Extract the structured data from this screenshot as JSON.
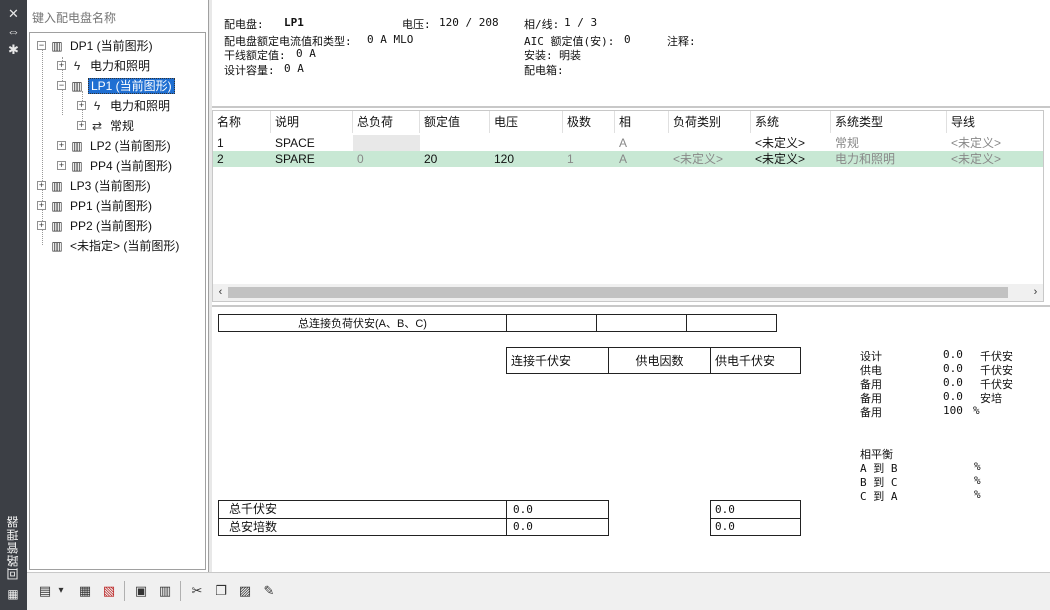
{
  "strip": {
    "title": "回路管理器",
    "close_glyph": "✕",
    "pin_glyph": "⇔",
    "settings_glyph": "✱",
    "bottom_glyph": "▦"
  },
  "tree": {
    "search_placeholder": "键入配电盘名称",
    "items": [
      {
        "label": "DP1 (当前图形)",
        "icon": "panel-icon",
        "expand": "−"
      },
      {
        "label": "电力和照明",
        "icon": "power-icon",
        "expand": "+"
      },
      {
        "label": "LP1 (当前图形)",
        "icon": "panel-icon",
        "expand": "−"
      },
      {
        "label": "电力和照明",
        "icon": "power-icon",
        "expand": "+"
      },
      {
        "label": "常规",
        "icon": "general-icon",
        "expand": "+"
      },
      {
        "label": "LP2 (当前图形)",
        "icon": "panel-icon",
        "expand": "+"
      },
      {
        "label": "PP4 (当前图形)",
        "icon": "panel-icon",
        "expand": "+"
      },
      {
        "label": "LP3 (当前图形)",
        "icon": "panel-icon",
        "expand": "+"
      },
      {
        "label": "PP1 (当前图形)",
        "icon": "panel-icon",
        "expand": "+"
      },
      {
        "label": "PP2 (当前图形)",
        "icon": "panel-icon",
        "expand": "+"
      },
      {
        "label": "<未指定> (当前图形)",
        "icon": "panel-icon",
        "expand": ""
      }
    ]
  },
  "header": {
    "panel_label": "配电盘:",
    "panel_value": "LP1",
    "voltage_label": "电压:",
    "voltage_value": "120 / 208",
    "phase_label": "相/线:",
    "phase_value": "1 / 3",
    "rating_label": "配电盘额定电流值和类型:",
    "rating_value": "0 A MLO",
    "aic_label": "AIC 额定值(安):",
    "aic_value": "0",
    "note_label": "注释:",
    "main_label": "干线额定值:",
    "main_value": "0 A",
    "mount_label": "安装:",
    "mount_value": "明装",
    "design_label": "设计容量:",
    "design_value": "0 A",
    "enclosure_label": "配电箱:"
  },
  "grid": {
    "columns": [
      "名称",
      "说明",
      "总负荷",
      "额定值",
      "电压",
      "极数",
      "相",
      "负荷类别",
      "系统",
      "系统类型",
      "导线"
    ],
    "rows": [
      [
        "1",
        "SPACE",
        "",
        "",
        "",
        "",
        "A",
        "",
        "<未定义>",
        "常规",
        "<未定义>"
      ],
      [
        "2",
        "SPARE",
        "0",
        "20",
        "120",
        "1",
        "A",
        "<未定义>",
        "<未定义>",
        "电力和照明",
        "<未定义>"
      ]
    ]
  },
  "summary": {
    "total_connected": "总连接负荷伏安(A、B、C)",
    "connected_kva": "连接千伏安",
    "demand_factor": "供电因数",
    "demand_kva": "供电千伏安",
    "total_kva": "总千伏安",
    "total_amps": "总安培数",
    "total_kva_value": "0.0",
    "total_amps_value": "0.0",
    "demand_total_kva_value": "0.0",
    "demand_total_amps_value": "0.0",
    "right": [
      {
        "label": "设计",
        "value": "0.0",
        "unit": "千伏安"
      },
      {
        "label": "供电",
        "value": "0.0",
        "unit": "千伏安"
      },
      {
        "label": "备用",
        "value": "0.0",
        "unit": "千伏安"
      },
      {
        "label": "备用",
        "value": "0.0",
        "unit": "安培"
      },
      {
        "label": "备用",
        "value": "100",
        "unit": "%"
      }
    ],
    "balance_title": "相平衡",
    "balance": [
      {
        "label": "A 到 B",
        "unit": "%"
      },
      {
        "label": "B 到 C",
        "unit": "%"
      },
      {
        "label": "C 到 A",
        "unit": "%"
      }
    ]
  },
  "toolbar": {
    "buttons": [
      {
        "name": "new-panel-button",
        "glyph": "▤"
      },
      {
        "name": "new-panel-dropdown",
        "glyph": "▾"
      },
      {
        "name": "panel-properties-button",
        "glyph": "▦"
      },
      {
        "name": "delete-panel-button",
        "glyph": "▧"
      },
      {
        "name": "copy-circuit-button",
        "glyph": "▣"
      },
      {
        "name": "paste-circuit-button",
        "glyph": "▥"
      },
      {
        "name": "cut-button",
        "glyph": "✂"
      },
      {
        "name": "copy-button",
        "glyph": "❐"
      },
      {
        "name": "paste-button",
        "glyph": "▨"
      },
      {
        "name": "assign-button",
        "glyph": "✎"
      }
    ]
  }
}
